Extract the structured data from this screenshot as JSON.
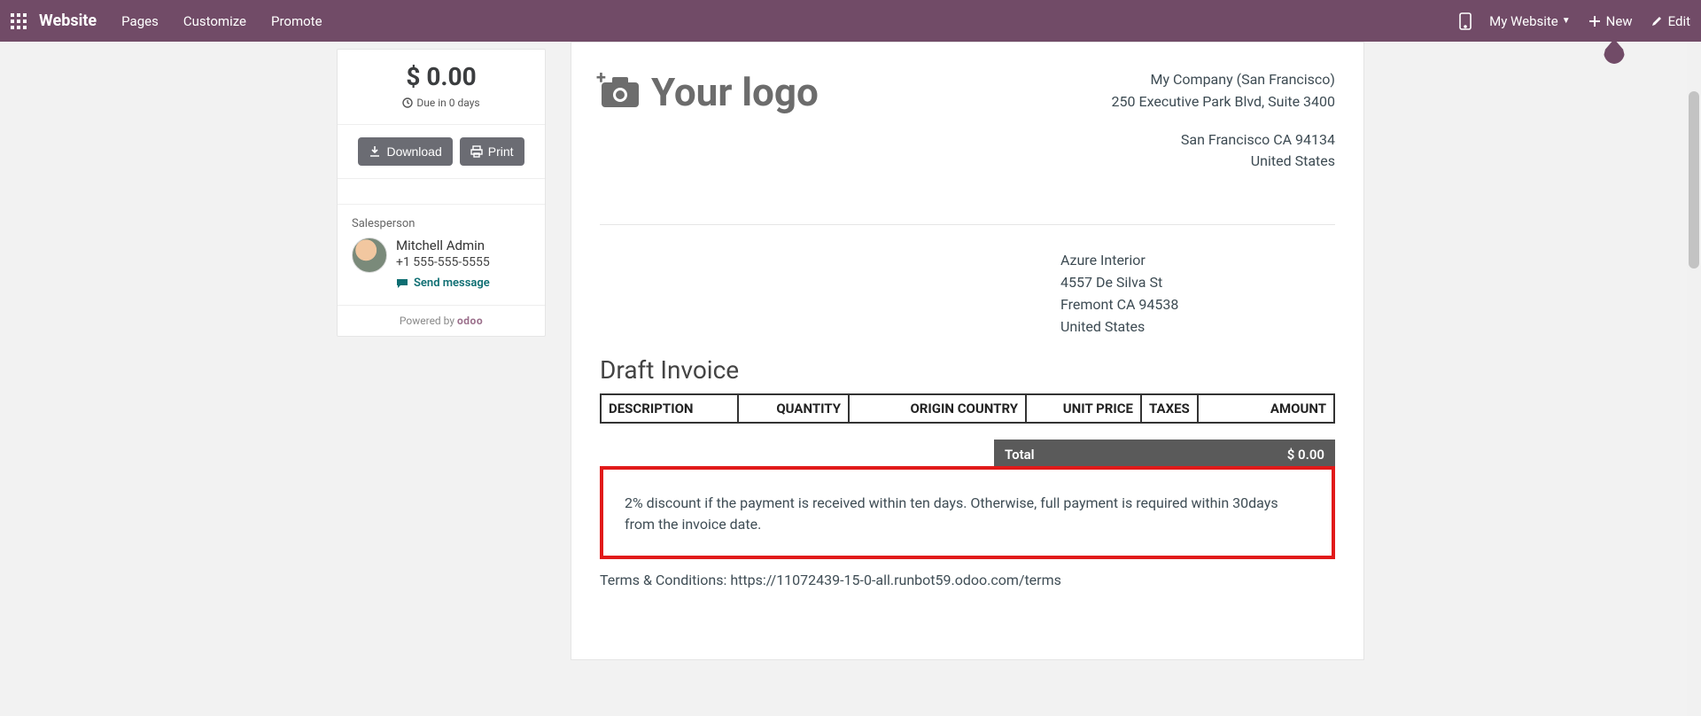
{
  "nav": {
    "brand": "Website",
    "menus": [
      "Pages",
      "Customize",
      "Promote"
    ],
    "my_website": "My Website",
    "new": "New",
    "edit": "Edit"
  },
  "sidebar": {
    "amount": "$ 0.00",
    "due": "Due in 0 days",
    "download": "Download",
    "print": "Print",
    "salesperson_label": "Salesperson",
    "salesperson_name": "Mitchell Admin",
    "salesperson_phone": "+1 555-555-5555",
    "send_message": "Send message",
    "powered_by": "Powered by",
    "powered_brand": "odoo"
  },
  "doc": {
    "logo_text": "Your logo",
    "company": {
      "name": "My Company (San Francisco)",
      "street": "250 Executive Park Blvd, Suite 3400",
      "citystate": "San Francisco CA 94134",
      "country": "United States"
    },
    "customer": {
      "name": "Azure Interior",
      "street": "4557 De Silva St",
      "citystate": "Fremont CA 94538",
      "country": "United States"
    },
    "title": "Draft Invoice",
    "columns": {
      "description": "DESCRIPTION",
      "quantity": "QUANTITY",
      "origin": "ORIGIN COUNTRY",
      "unit_price": "UNIT PRICE",
      "taxes": "TAXES",
      "amount": "AMOUNT"
    },
    "total_label": "Total",
    "total_value": "$ 0.00",
    "payment_terms_note": "2% discount if the payment is received within ten days. Otherwise, full payment is required within 30days from the invoice date.",
    "terms_line": "Terms & Conditions: https://11072439-15-0-all.runbot59.odoo.com/terms"
  }
}
